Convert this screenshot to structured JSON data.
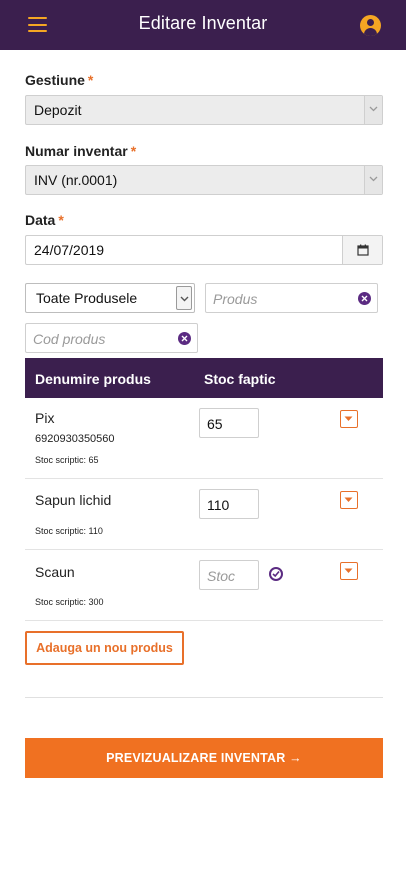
{
  "header": {
    "title": "Editare Inventar",
    "menu_icon": "hamburger-menu-icon",
    "user_icon": "user-circle-icon",
    "accent_color": "#f5a623",
    "background_color": "#3b1f4e"
  },
  "form": {
    "gestiune": {
      "label": "Gestiune",
      "required_mark": "*",
      "value": "Depozit"
    },
    "numar_inventar": {
      "label": "Numar inventar",
      "required_mark": "*",
      "value": "INV (nr.0001)"
    },
    "data": {
      "label": "Data",
      "required_mark": "*",
      "value": "24/07/2019",
      "calendar_icon": "calendar-icon"
    }
  },
  "filters": {
    "product_type": {
      "value": "Toate Produsele"
    },
    "product_search": {
      "placeholder": "Produs"
    },
    "code_search": {
      "placeholder": "Cod produs"
    }
  },
  "table": {
    "columns": [
      "Denumire produs",
      "Stoc faptic"
    ],
    "rows": [
      {
        "name": "Pix",
        "code": "6920930350560",
        "scriptic": "Stoc scriptic: 65",
        "stock_value": "65"
      },
      {
        "name": "Sapun lichid",
        "code": "",
        "scriptic": "Stoc scriptic: 110",
        "stock_value": "110"
      },
      {
        "name": "Scaun",
        "code": "",
        "scriptic": "Stoc scriptic: 300",
        "stock_value": "",
        "stock_placeholder": "Stoc"
      }
    ]
  },
  "actions": {
    "add_product": "Adauga un nou produs",
    "preview": "PREVIZUALIZARE INVENTAR →",
    "primary_color": "#f07121"
  }
}
